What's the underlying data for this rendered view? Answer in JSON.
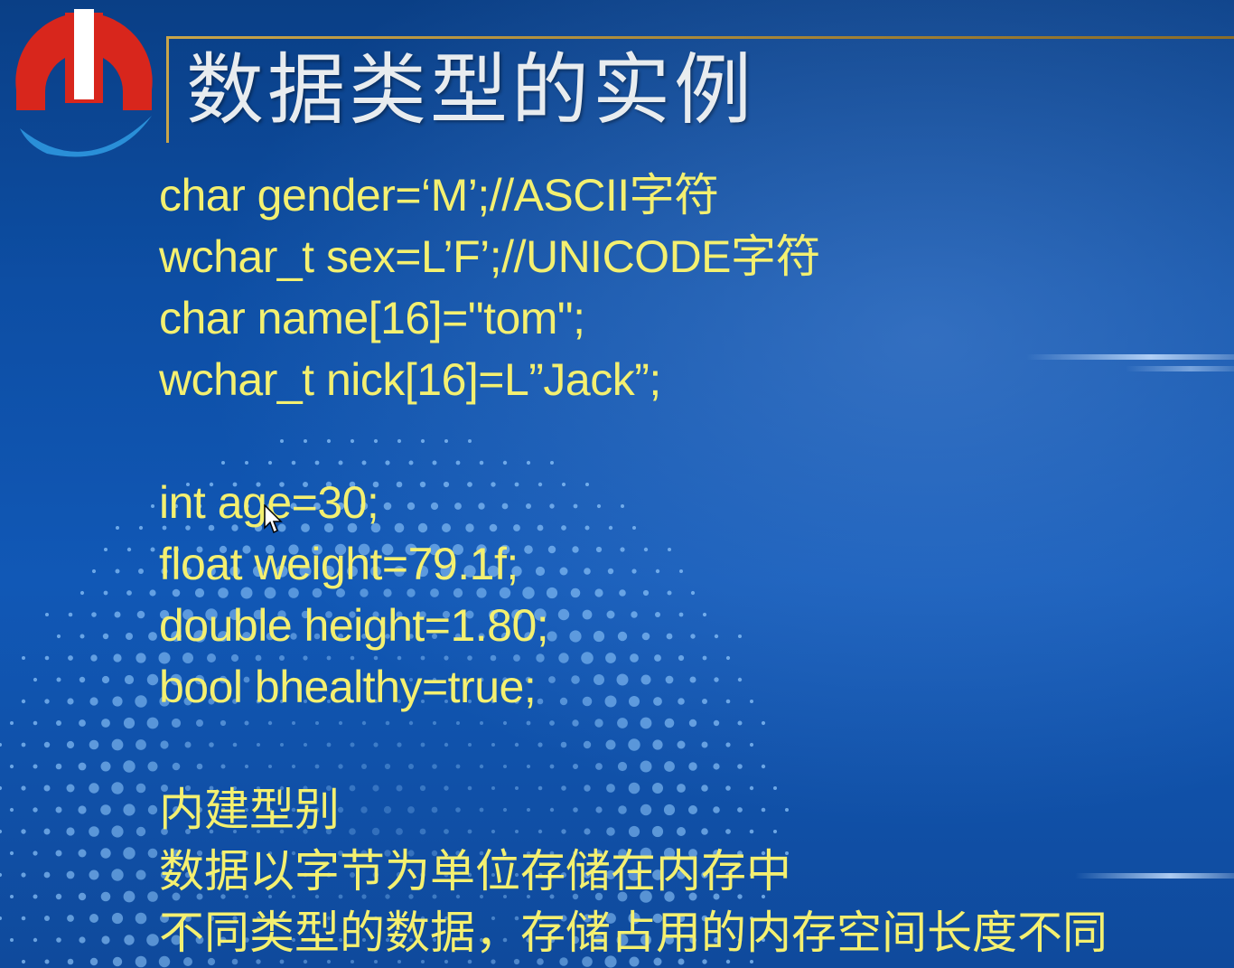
{
  "slide": {
    "title": "数据类型的实例",
    "code_group_1": [
      "char gender=‘M’;//ASCII字符",
      "wchar_t sex=L’F’;//UNICODE字符",
      "char name[16]=\"tom\";",
      "wchar_t nick[16]=L”Jack”;"
    ],
    "code_group_2": [
      "int age=30;",
      "float weight=79.1f;",
      "double height=1.80;",
      "bool bhealthy=true;"
    ],
    "notes": [
      "内建型别",
      "数据以字节为单位存储在内存中",
      "不同类型的数据，存储占用的内存空间长度不同"
    ]
  },
  "icons": {
    "logo": "logo-icon",
    "cursor": "mouse-cursor-icon"
  },
  "colors": {
    "background": "#0d4ea4",
    "code_text": "#f4f070",
    "title_text": "#e8ecef",
    "frame": "#c9a54a",
    "logo_red": "#d8261c",
    "logo_blue": "#2a8fd8"
  }
}
